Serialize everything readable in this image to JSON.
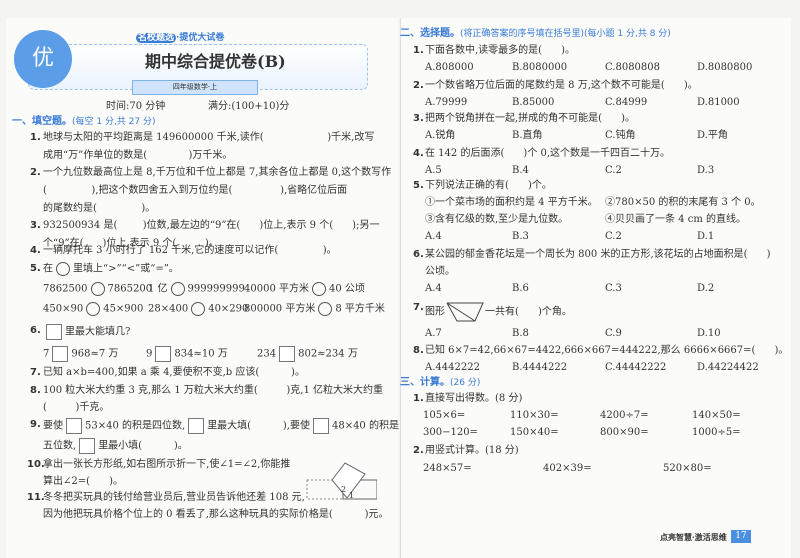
{
  "header": {
    "series_badge": "名校题选",
    "series": "·提优大试卷",
    "logo_char": "优",
    "title": "期中综合提优卷(B)",
    "grade": "四年级数学·上",
    "time": "时间:70 分钟",
    "score": "满分:(100+10)分"
  },
  "s1": {
    "title": "一、填空题。",
    "note": "(每空 1 分,共 27 分)",
    "q1": [
      "1.",
      "地球与太阳的平均距离是 149600000 千米,读作(                    )千米,改写",
      "成用“万”作单位的数是(             )万千米。"
    ],
    "q2": [
      "2.",
      "一个九位数最高位上是 8,千万位和千位上都是 7,其余各位上都是 0,这个数写作",
      "(              ),把这个数四舍五入到万位约是(               ),省略亿位后面",
      "的尾数约是(              )。"
    ],
    "q3": [
      "3.",
      "932500934 是(        )位数,最左边的“9”在(      )位上,表示 9 个(      );另一",
      "个“9”在(      )位上,表示 9 个(         )。"
    ],
    "q4": [
      "4.",
      "一辆摩托车 3 小时行了 162 千米,它的速度可以记作(              )。"
    ],
    "q5": [
      "5.",
      "在",
      "里填上“>”“<”或“=”。"
    ],
    "q5r": [
      [
        "7862500",
        "7865200"
      ],
      [
        "1 亿",
        "999999999"
      ],
      [
        "40000 平方米",
        "40 公顷"
      ],
      [
        "450×90",
        "45×900"
      ],
      [
        "28×400",
        "40×290"
      ],
      [
        "800000 平方米",
        "8 平方千米"
      ]
    ],
    "q6": [
      "6.",
      "里最大能填几?"
    ],
    "q6r": [
      [
        "7",
        "968≈7 万"
      ],
      [
        "9",
        "834≈10 万"
      ],
      [
        "234",
        "802≈234 万"
      ]
    ],
    "q7": [
      "7.",
      "已知 a×b=400,如果 a 乘 4,要使积不变,b 应该(          )。"
    ],
    "q8": [
      "8.",
      "100 粒大米大约重 3 克,那么 1 万粒大米大约重(         )克,1 亿粒大米大约重",
      "(         )千克。"
    ],
    "q9": [
      "9.",
      "要使",
      "53×40 的积是四位数,",
      "里最大填(          ),要使",
      "48×40 的积是",
      "五位数,",
      "里最小填(          )。"
    ],
    "q10": [
      "10.",
      "拿出一张长方形纸,如右图所示折一下,使∠1=∠2,你能推",
      "算出∠2=(      )。"
    ],
    "q11": [
      "11.",
      "冬冬把买玩具的钱付给营业员后,营业员告诉他还差 108 元,",
      "因为他把玩具价格个位上的 0 看丢了,那么这种玩具的实际价格是(          )元。"
    ],
    "fig_labels": [
      "2",
      "1"
    ]
  },
  "s2": {
    "title": "二、选择题。",
    "note": "(将正确答案的序号填在括号里)(每小题 1 分,共 8 分)",
    "qs": [
      {
        "n": "1.",
        "t": "下面各数中,读零最多的是(      )。",
        "o": [
          "A.808000",
          "B.8080000",
          "C.8080808",
          "D.8080800"
        ]
      },
      {
        "n": "2.",
        "t": "一个数省略万位后面的尾数约是 8 万,这个数不可能是(      )。",
        "o": [
          "A.79999",
          "B.85000",
          "C.84999",
          "D.81000"
        ]
      },
      {
        "n": "3.",
        "t": "把两个锐角拼在一起,拼成的角不可能是(      )。",
        "o": [
          "A.锐角",
          "B.直角",
          "C.钝角",
          "D.平角"
        ]
      },
      {
        "n": "4.",
        "t": "在 142 的后面添(      )个 0,这个数是一千四百二十万。",
        "o": [
          "A.5",
          "B.4",
          "C.2",
          "D.3"
        ]
      },
      {
        "n": "5.",
        "t": "下列说法正确的有(      )个。",
        "s": [
          "①一个菜市场的面积约是 4 平方千米。",
          "②780×50 的积的末尾有 3 个 0。",
          "③含有亿级的数,至少是九位数。",
          "④贝贝画了一条 4 cm 的直线。"
        ],
        "o": [
          "A.4",
          "B.3",
          "C.2",
          "D.1"
        ]
      },
      {
        "n": "6.",
        "t": "某公园的郁金香花坛是一个周长为 800 米的正方形,该花坛的占地面积是(      )",
        "t2": "公顷。",
        "o": [
          "A.4",
          "B.6",
          "C.3",
          "D.2"
        ]
      },
      {
        "n": "7.",
        "t": "图形",
        "t2": "一共有(      )个角。",
        "o": [
          "A.7",
          "B.8",
          "C.9",
          "D.10"
        ]
      },
      {
        "n": "8.",
        "t": "已知 6×7=42,66×67=4422,666×667=444222,那么 6666×6667=(      )。",
        "o": [
          "A.4442222",
          "B.4444222",
          "C.44442222",
          "D.44224422"
        ]
      }
    ]
  },
  "s3": {
    "title": "三、计算。",
    "note": "(26 分)",
    "q1": [
      "1.",
      "直接写出得数。(8 分)"
    ],
    "r1": [
      "105×6=",
      "110×30=",
      "4200÷7=",
      "140×50=",
      "300−120=",
      "150×40=",
      "800×90=",
      "1000÷5="
    ],
    "q2": [
      "2.",
      "用竖式计算。(18 分)"
    ],
    "r2": [
      "248×57=",
      "402×39=",
      "520×80="
    ]
  },
  "footer": {
    "slogan": "点亮智慧·激活思维",
    "page": "17"
  }
}
